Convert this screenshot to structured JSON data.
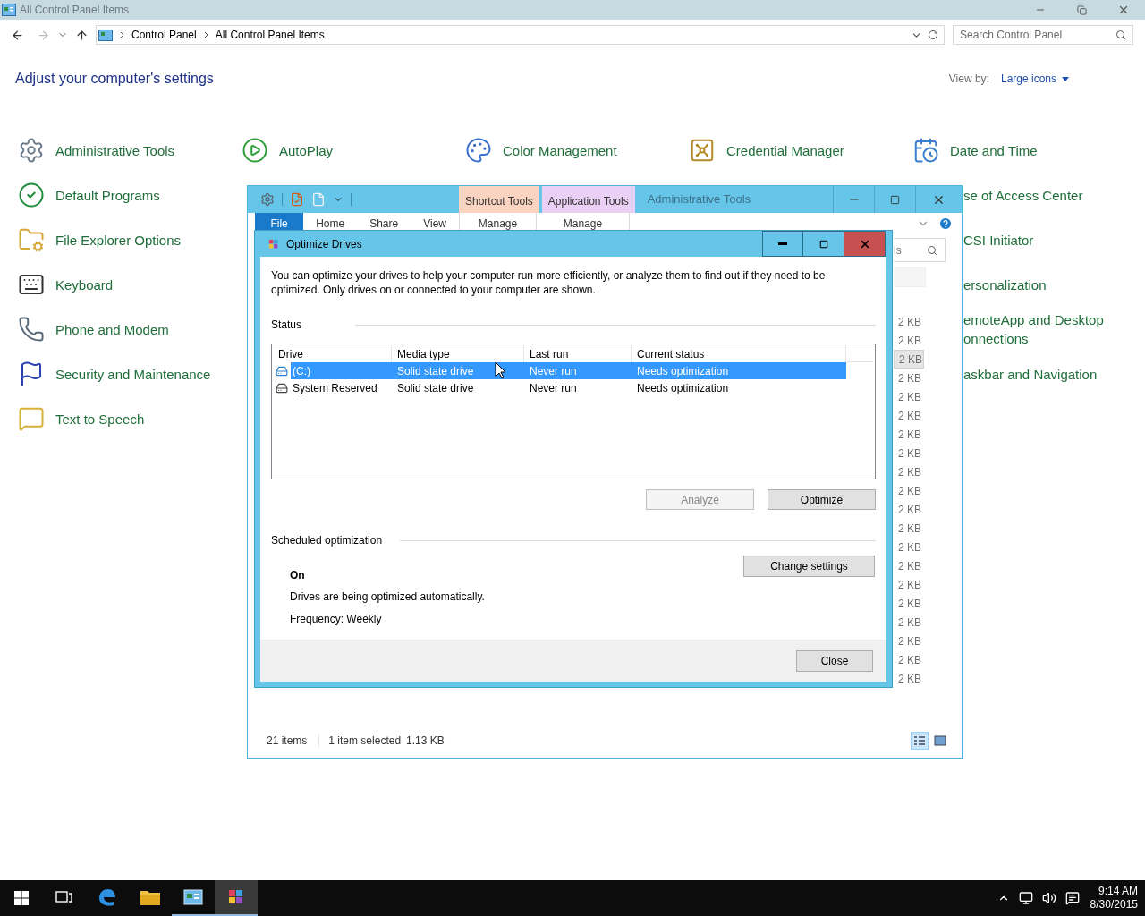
{
  "control_panel": {
    "title": "All Control Panel Items",
    "breadcrumbs": [
      "Control Panel",
      "All Control Panel Items"
    ],
    "search": {
      "placeholder": "Search Control Panel"
    },
    "heading": "Adjust your computer's settings",
    "view_by": {
      "label": "View by:",
      "value": "Large icons"
    },
    "columns": [
      [
        {
          "label": "Administrative Tools",
          "kind": "admin"
        },
        {
          "label": "Default Programs",
          "kind": "defaults"
        },
        {
          "label": "File Explorer Options",
          "kind": "folder"
        },
        {
          "label": "Keyboard",
          "kind": "keyboard"
        },
        {
          "label": "Phone and Modem",
          "kind": "phone"
        },
        {
          "label": "Security and Maintenance",
          "kind": "flag"
        },
        {
          "label": "Text to Speech",
          "kind": "speech"
        }
      ],
      [
        {
          "label": "AutoPlay",
          "kind": "autoplay"
        }
      ],
      [
        {
          "label": "Color Management",
          "kind": "color"
        }
      ],
      [
        {
          "label": "Credential Manager",
          "kind": "vault"
        }
      ],
      [
        {
          "label": "Date and Time",
          "kind": "clock"
        },
        {
          "label": "se of Access Center",
          "kind": "partial"
        },
        {
          "label": "CSI Initiator",
          "kind": "partial"
        },
        {
          "label": "ersonalization",
          "kind": "partial"
        },
        {
          "label": "emoteApp and Desktop onnections",
          "kind": "partial"
        },
        {
          "label": "askbar and Navigation",
          "kind": "partial"
        }
      ]
    ]
  },
  "explorer": {
    "title": "Administrative Tools",
    "contextual": [
      {
        "label": "Shortcut Tools",
        "tab": "Manage",
        "color": "#fbd3c1"
      },
      {
        "label": "Application Tools",
        "tab": "Manage",
        "color": "#ebd0f5"
      }
    ],
    "tabs": [
      {
        "label": "File",
        "kind": "file"
      },
      {
        "label": "Home",
        "kind": "tab"
      },
      {
        "label": "Share",
        "kind": "tab"
      },
      {
        "label": "View",
        "kind": "tab"
      }
    ],
    "search": {
      "placeholder": "ls"
    },
    "sizes": [
      {
        "text": "2 KB",
        "selected": false
      },
      {
        "text": "2 KB",
        "selected": false
      },
      {
        "text": "2 KB",
        "selected": true
      },
      {
        "text": "2 KB",
        "selected": false
      },
      {
        "text": "2 KB",
        "selected": false
      },
      {
        "text": "2 KB",
        "selected": false
      },
      {
        "text": "2 KB",
        "selected": false
      },
      {
        "text": "2 KB",
        "selected": false
      },
      {
        "text": "2 KB",
        "selected": false
      },
      {
        "text": "2 KB",
        "selected": false
      },
      {
        "text": "2 KB",
        "selected": false
      },
      {
        "text": "2 KB",
        "selected": false
      },
      {
        "text": "2 KB",
        "selected": false
      },
      {
        "text": "2 KB",
        "selected": false
      },
      {
        "text": "2 KB",
        "selected": false
      },
      {
        "text": "2 KB",
        "selected": false
      },
      {
        "text": "2 KB",
        "selected": false
      },
      {
        "text": "2 KB",
        "selected": false
      },
      {
        "text": "2 KB",
        "selected": false
      },
      {
        "text": "2 KB",
        "selected": false
      }
    ],
    "status": {
      "count": "21 items",
      "selection": "1 item selected",
      "size": "1.13 KB"
    }
  },
  "dialog": {
    "title": "Optimize Drives",
    "intro": "You can optimize your drives to help your computer run more efficiently, or analyze them to find out if they need to be optimized. Only drives on or connected to your computer are shown.",
    "status_heading": "Status",
    "columns": [
      "Drive",
      "Media type",
      "Last run",
      "Current status"
    ],
    "drives": [
      {
        "name": "(C:)",
        "media_type": "Solid state drive",
        "last_run": "Never run",
        "current_status": "Needs optimization",
        "kind": "system",
        "selected": true
      },
      {
        "name": "System Reserved",
        "media_type": "Solid state drive",
        "last_run": "Never run",
        "current_status": "Needs optimization",
        "kind": "disk",
        "selected": false
      }
    ],
    "buttons": [
      {
        "label": "Analyze",
        "disabled": true
      },
      {
        "label": "Optimize",
        "disabled": false
      }
    ],
    "schedule": {
      "heading": "Scheduled optimization",
      "state": "On",
      "description": "Drives are being optimized automatically.",
      "frequency": "Frequency: Weekly",
      "button": "Change settings"
    },
    "close": "Close"
  },
  "taskbar": {
    "apps": [
      {
        "kind": "taskview",
        "running": false,
        "focused": false
      },
      {
        "kind": "edge",
        "running": false,
        "focused": false
      },
      {
        "kind": "explorer",
        "running": false,
        "focused": false
      },
      {
        "kind": "controlpanel",
        "running": true,
        "focused": false
      },
      {
        "kind": "defrag",
        "running": true,
        "focused": true
      }
    ],
    "time": "9:14 AM",
    "date": "8/30/2015"
  }
}
